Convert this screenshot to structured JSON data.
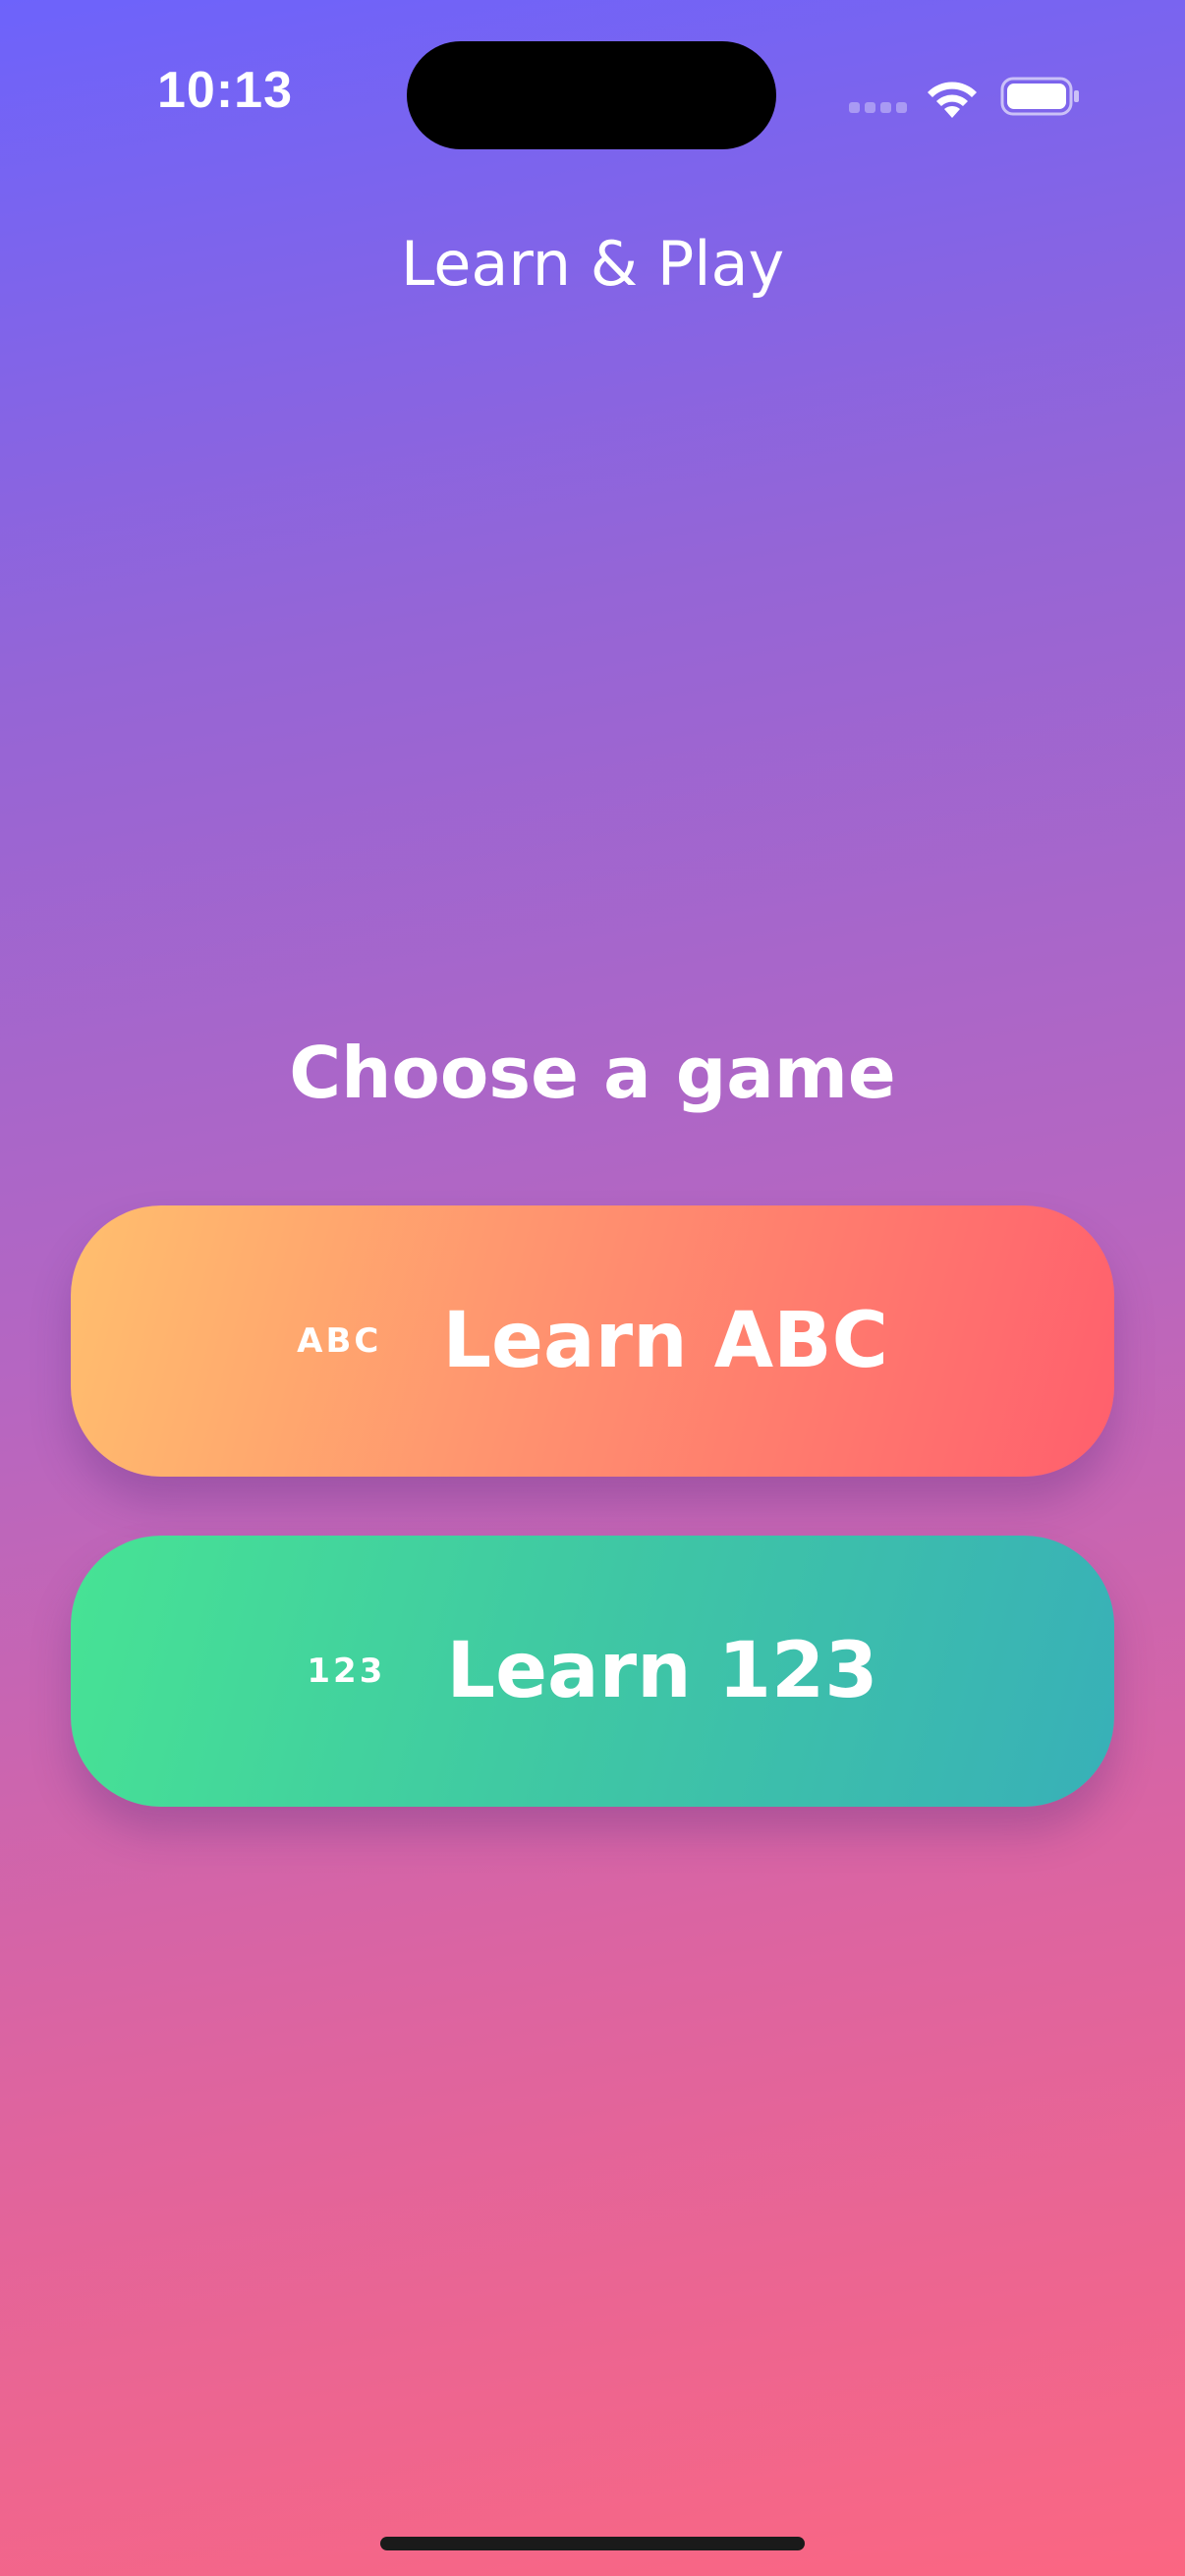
{
  "status_bar": {
    "time": "10:13"
  },
  "header": {
    "title": "Learn & Play"
  },
  "main": {
    "section_title": "Choose a game",
    "games": [
      {
        "icon_text": "ABC",
        "label": "Learn ABC",
        "gradient": [
          "#ffbf6e",
          "#ff5f6d"
        ]
      },
      {
        "icon_text": "123",
        "label": "Learn 123",
        "gradient": [
          "#47e394",
          "#38b0b8"
        ]
      }
    ]
  },
  "colors": {
    "background_top": "#6d63fb",
    "background_bottom": "#fb6682",
    "text": "#ffffff"
  }
}
